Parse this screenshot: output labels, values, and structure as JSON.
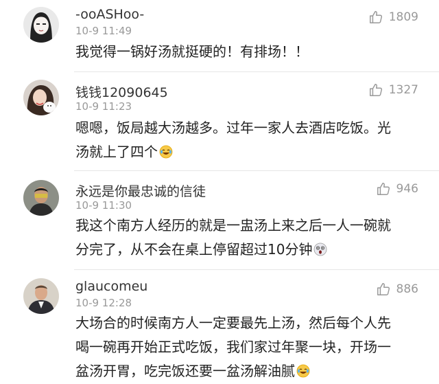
{
  "comments": [
    {
      "username": "-ooASHoo-",
      "time": "10-9 11:49",
      "likes": "1809",
      "lines": [
        "我觉得一锅好汤就挺硬的！有排场！！"
      ],
      "avatar_icon": "anime-girl-avatar",
      "emoji": null
    },
    {
      "username": "钱钱12090645",
      "time": "10-9 11:23",
      "likes": "1327",
      "lines": [
        "嗯嗯，饭局越大汤越多。过年一家人去酒店吃饭。光",
        "汤就上了四个"
      ],
      "avatar_icon": "woman-with-puppy-avatar",
      "emoji": "laugh-cry-emoji"
    },
    {
      "username": "永远是你最忠诚的信徒",
      "time": "10-9 11:30",
      "likes": "946",
      "lines": [
        "我这个南方人经历的就是一盅汤上来之后一人一碗就",
        "分完了，从不会在桌上停留超过10分钟"
      ],
      "avatar_icon": "man-portrait-avatar",
      "emoji": "shocked-face-emoji"
    },
    {
      "username": "glaucomeu",
      "time": "10-9 12:28",
      "likes": "886",
      "lines": [
        "大场合的时候南方人一定要最先上汤，然后每个人先",
        "喝一碗再开始正式吃饭，我们家过年聚一块，开场一",
        "盆汤开胃，吃完饭还要一盆汤解油腻"
      ],
      "avatar_icon": "man-in-suit-avatar",
      "emoji": "laugh-cry-emoji"
    }
  ],
  "colors": {
    "text": "#222222",
    "meta": "#999999",
    "divider": "#e6e6e6"
  }
}
